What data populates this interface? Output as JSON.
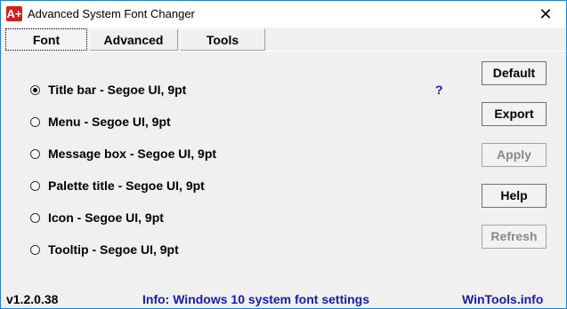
{
  "window": {
    "title": "Advanced System Font Changer",
    "app_icon_text": "A+",
    "close_glyph": "✕"
  },
  "tabs": [
    {
      "label": "Font",
      "active": true
    },
    {
      "label": "Advanced",
      "active": false
    },
    {
      "label": "Tools",
      "active": false
    }
  ],
  "font_options": [
    {
      "label": "Title bar - Segoe UI, 9pt",
      "checked": true
    },
    {
      "label": "Menu - Segoe UI, 9pt",
      "checked": false
    },
    {
      "label": "Message box - Segoe UI, 9pt",
      "checked": false
    },
    {
      "label": "Palette title - Segoe UI, 9pt",
      "checked": false
    },
    {
      "label": "Icon - Segoe UI, 9pt",
      "checked": false
    },
    {
      "label": "Tooltip - Segoe UI, 9pt",
      "checked": false
    }
  ],
  "help_link": "?",
  "buttons": {
    "default": "Default",
    "export": "Export",
    "apply": "Apply",
    "help": "Help",
    "refresh": "Refresh"
  },
  "footer": {
    "version": "v1.2.0.38",
    "info": "Info: Windows 10 system font settings",
    "site": "WinTools.info"
  },
  "colors": {
    "accent_border": "#1883d7",
    "link_blue": "#1a1aa6",
    "app_icon_red": "#d21f1f"
  }
}
